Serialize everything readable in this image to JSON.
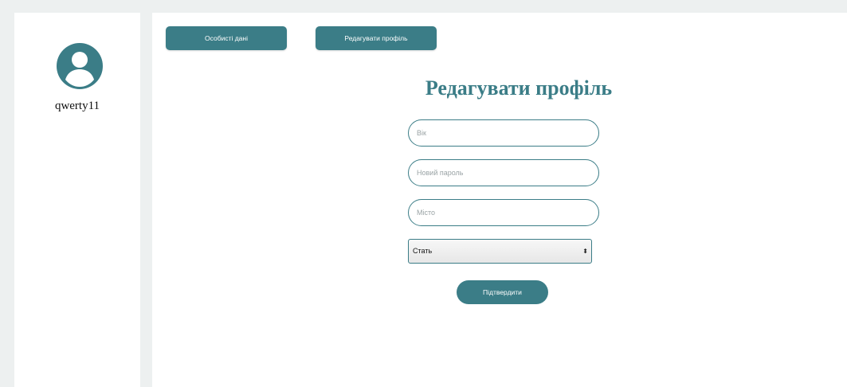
{
  "sidebar": {
    "username": "qwerty11",
    "avatar_icon": "user-avatar-icon"
  },
  "tabs": {
    "personal_label": "Особисті дані",
    "edit_label": "Редагувати профіль"
  },
  "form": {
    "title": "Редагувати профіль",
    "age_placeholder": "Вік",
    "password_placeholder": "Новий пароль",
    "city_placeholder": "Місто",
    "gender_select_value": "Стать",
    "submit_label": "Підтвердити"
  },
  "colors": {
    "accent": "#3b7d87",
    "background": "#edf0f0",
    "panel": "#ffffff"
  }
}
